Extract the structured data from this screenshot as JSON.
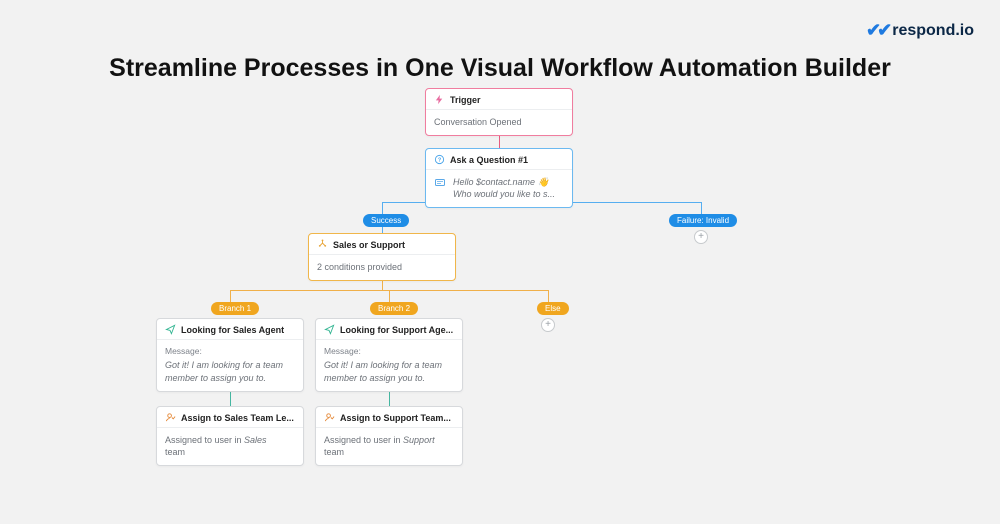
{
  "brand": {
    "name": "respond.io"
  },
  "title": "Streamline Processes in One Visual Workflow Automation Builder",
  "nodes": {
    "trigger": {
      "title": "Trigger",
      "subtitle": "Conversation Opened"
    },
    "ask": {
      "title": "Ask a Question #1",
      "line1": "Hello $contact.name 👋",
      "line2": "Who would you like to s..."
    },
    "branch": {
      "title": "Sales or Support",
      "subtitle": "2 conditions provided"
    },
    "sales": {
      "title": "Looking for Sales Agent",
      "msglabel": "Message:",
      "msg": "Got it! I am looking for a team member to assign you to."
    },
    "support": {
      "title": "Looking for Support Age...",
      "msglabel": "Message:",
      "msg": "Got it! I am looking for a team member to assign you to."
    },
    "assignSales": {
      "title": "Assign to Sales Team Le...",
      "line_a": "Assigned to user in ",
      "line_em": "Sales",
      "line_b": "team"
    },
    "assignSupport": {
      "title": "Assign to Support Team...",
      "line_a": "Assigned to user in ",
      "line_em": "Support",
      "line_b": "team"
    }
  },
  "pills": {
    "success": "Success",
    "failure": "Failure: Invalid",
    "branch1": "Branch 1",
    "branch2": "Branch 2",
    "else": "Else"
  }
}
